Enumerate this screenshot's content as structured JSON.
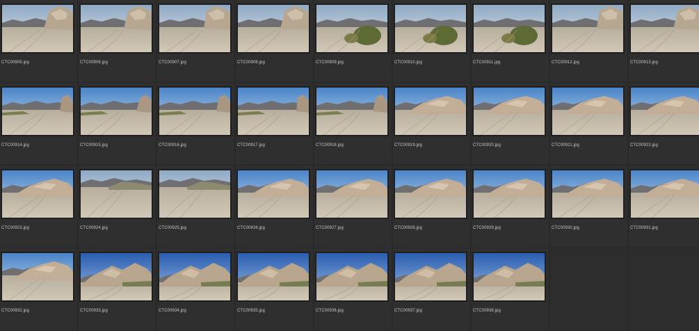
{
  "files": [
    {
      "name": "CTC00905.jpg",
      "scene": "canyon"
    },
    {
      "name": "CTC00906.jpg",
      "scene": "canyon"
    },
    {
      "name": "CTC00907.jpg",
      "scene": "canyon"
    },
    {
      "name": "CTC00908.jpg",
      "scene": "canyon"
    },
    {
      "name": "CTC00909.jpg",
      "scene": "brush"
    },
    {
      "name": "CTC00910.jpg",
      "scene": "brush"
    },
    {
      "name": "CTC00911.jpg",
      "scene": "brush"
    },
    {
      "name": "CTC00912.jpg",
      "scene": "canyon"
    },
    {
      "name": "CTC00913.jpg",
      "scene": "canyon"
    },
    {
      "name": "CTC00914.jpg",
      "scene": "road"
    },
    {
      "name": "CTC00915.jpg",
      "scene": "road"
    },
    {
      "name": "CTC00916.jpg",
      "scene": "road"
    },
    {
      "name": "CTC00917.jpg",
      "scene": "road"
    },
    {
      "name": "CTC00918.jpg",
      "scene": "road"
    },
    {
      "name": "CTC00919.jpg",
      "scene": "rocks"
    },
    {
      "name": "CTC00920.jpg",
      "scene": "rocks"
    },
    {
      "name": "CTC00921.jpg",
      "scene": "rocks"
    },
    {
      "name": "CTC00922.jpg",
      "scene": "rocks"
    },
    {
      "name": "CTC00923.jpg",
      "scene": "rocks"
    },
    {
      "name": "CTC00924.jpg",
      "scene": "wash"
    },
    {
      "name": "CTC00925.jpg",
      "scene": "wash"
    },
    {
      "name": "CTC00926.jpg",
      "scene": "rocks"
    },
    {
      "name": "CTC00927.jpg",
      "scene": "rocks"
    },
    {
      "name": "CTC00928.jpg",
      "scene": "rocks"
    },
    {
      "name": "CTC00929.jpg",
      "scene": "rocks"
    },
    {
      "name": "CTC00930.jpg",
      "scene": "rocks"
    },
    {
      "name": "CTC00931.jpg",
      "scene": "rocks"
    },
    {
      "name": "CTC00932.jpg",
      "scene": "rocks"
    },
    {
      "name": "CTC00933.jpg",
      "scene": "deep"
    },
    {
      "name": "CTC00934.jpg",
      "scene": "deep"
    },
    {
      "name": "CTC00935.jpg",
      "scene": "deep"
    },
    {
      "name": "CTC00936.jpg",
      "scene": "deep"
    },
    {
      "name": "CTC00937.jpg",
      "scene": "deep"
    },
    {
      "name": "CTC00938.jpg",
      "scene": "deep"
    }
  ],
  "colors": {
    "background": "#2b2b2b",
    "cell": "#2f2f2f",
    "label": "#c9c9c9",
    "sky_light": "#cfd9e2",
    "sky_blue": "#3f78c2",
    "ground": "#bdb3a4",
    "rock": "#c8b59f",
    "brush": "#6b7440"
  }
}
